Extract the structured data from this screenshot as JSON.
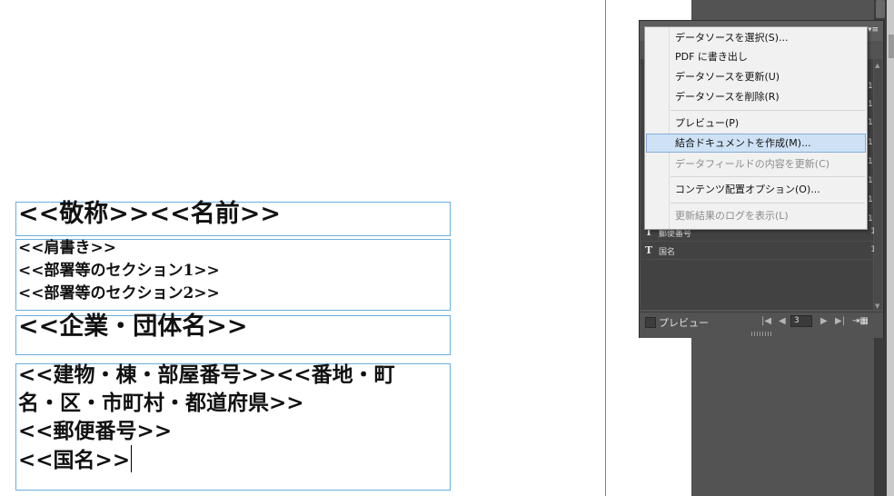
{
  "document": {
    "frames": [
      {
        "lines": [
          "<<敬称>><<名前>>"
        ]
      },
      {
        "lines": [
          "<<肩書き>>",
          "<<部署等のセクション1>>",
          "<<部署等のセクション2>>"
        ]
      },
      {
        "lines": [
          "<<企業・団体名>>"
        ]
      },
      {
        "lines": [
          "<<建物・棟・部屋番号>><<番地・町",
          "名・区・市町村・都道府県>>",
          "<<郵便番号>>",
          "<<国名>>"
        ]
      }
    ]
  },
  "panel": {
    "fields": [
      {
        "name": "郵便番号",
        "count": "1"
      },
      {
        "name": "国名",
        "count": "1"
      }
    ],
    "hidden_counts": [
      "1",
      "1",
      "1",
      "1",
      "1",
      "1",
      "1",
      "1",
      "1"
    ],
    "preview_label": "プレビュー",
    "page_number": "3",
    "menu": {
      "items": [
        {
          "label": "データソースを選択(S)...",
          "disabled": false
        },
        {
          "label": "PDF に書き出し",
          "disabled": false
        },
        {
          "label": "データソースを更新(U)",
          "disabled": false
        },
        {
          "label": "データソースを削除(R)",
          "disabled": false
        },
        {
          "label": "プレビュー(P)",
          "disabled": false
        },
        {
          "label": "結合ドキュメントを作成(M)...",
          "disabled": false,
          "highlighted": true
        },
        {
          "label": "データフィールドの内容を更新(C)",
          "disabled": true
        },
        {
          "label": "コンテンツ配置オプション(O)...",
          "disabled": false
        },
        {
          "label": "更新結果のログを表示(L)",
          "disabled": true
        }
      ]
    }
  },
  "colors": {
    "frame_border": "#6aaedc",
    "margin_guide": "#a35ad6",
    "menu_highlight": "#cfe2f5"
  }
}
